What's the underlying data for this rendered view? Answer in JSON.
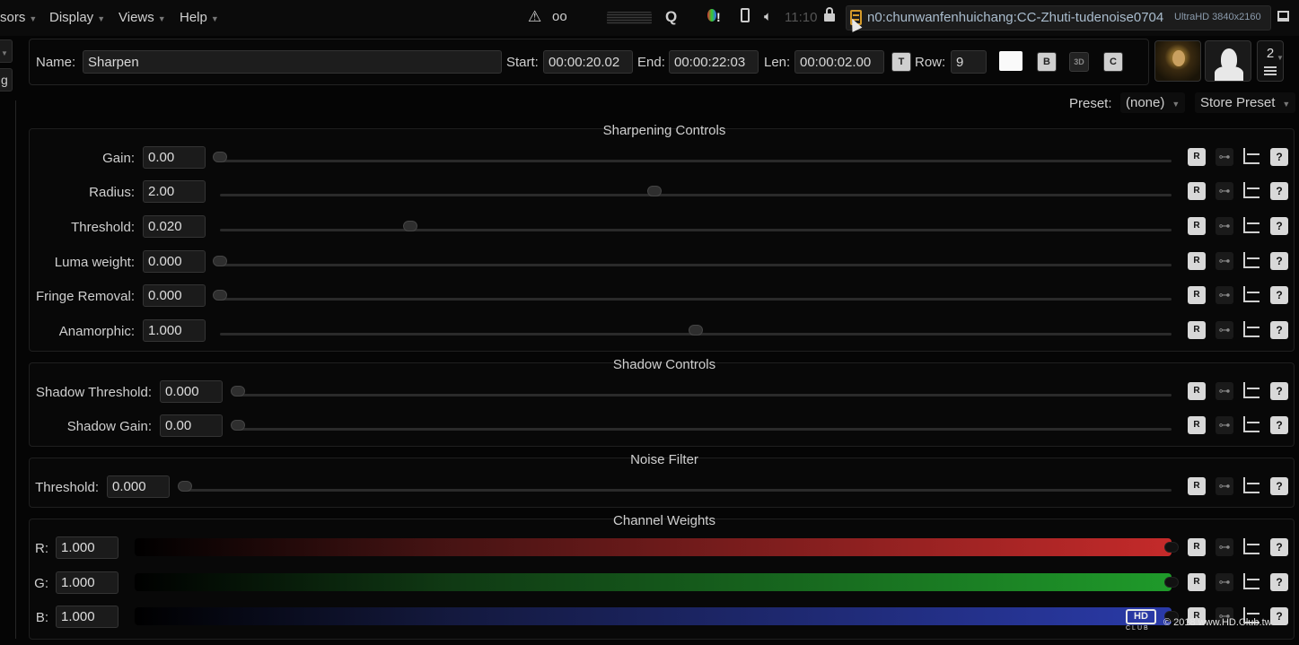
{
  "menubar": {
    "items": [
      {
        "label": "sors"
      },
      {
        "label": "Display"
      },
      {
        "label": "Views"
      },
      {
        "label": "Help"
      }
    ],
    "clock": "11:10",
    "project_name": "n0:chunwanfenhuichang:CC-Zhuti-tudenoise0704",
    "project_resolution": "UltraHD 3840x2160"
  },
  "left_fragments": [
    "",
    "g"
  ],
  "header": {
    "name_label": "Name:",
    "name_value": "Sharpen",
    "start_label": "Start:",
    "start_value": "00:00:20.02",
    "end_label": "End:",
    "end_value": "00:00:22:03",
    "len_label": "Len:",
    "len_value": "00:00:02.00",
    "row_label": "Row:",
    "row_value": "9",
    "layer_count": "2"
  },
  "preset": {
    "label": "Preset:",
    "value": "(none)",
    "store_label": "Store Preset"
  },
  "sections": {
    "sharpening": {
      "title": "Sharpening Controls",
      "params": [
        {
          "label": "Gain:",
          "value": "0.00",
          "level": 0.0
        },
        {
          "label": "Radius:",
          "value": "2.00",
          "level": 0.457
        },
        {
          "label": "Threshold:",
          "value": "0.020",
          "level": 0.2
        },
        {
          "label": "Luma weight:",
          "value": "0.000",
          "level": 0.0
        },
        {
          "label": "Fringe Removal:",
          "value": "0.000",
          "level": 0.0
        },
        {
          "label": "Anamorphic:",
          "value": "1.000",
          "level": 0.5
        }
      ]
    },
    "shadow": {
      "title": "Shadow Controls",
      "params": [
        {
          "label": "Shadow Threshold:",
          "value": "0.000",
          "level": 0.0
        },
        {
          "label": "Shadow Gain:",
          "value": "0.00",
          "level": 0.0
        }
      ]
    },
    "noise": {
      "title": "Noise Filter",
      "params": [
        {
          "label": "Threshold:",
          "value": "0.000",
          "level": 0.0
        }
      ]
    },
    "channels": {
      "title": "Channel Weights",
      "params": [
        {
          "label": "R:",
          "value": "1.000",
          "level": 1.0,
          "color": "#c42a2a"
        },
        {
          "label": "G:",
          "value": "1.000",
          "level": 1.0,
          "color": "#1f9a2a"
        },
        {
          "label": "B:",
          "value": "1.000",
          "level": 1.0,
          "color": "#2a3aa8"
        }
      ]
    }
  },
  "row_buttons": {
    "reset": "R",
    "key": "⊶",
    "help": "?"
  },
  "watermark": {
    "logo": "HD",
    "logo_sub": "CLUB",
    "text": "© 2018 www.HD.Club.tw"
  }
}
